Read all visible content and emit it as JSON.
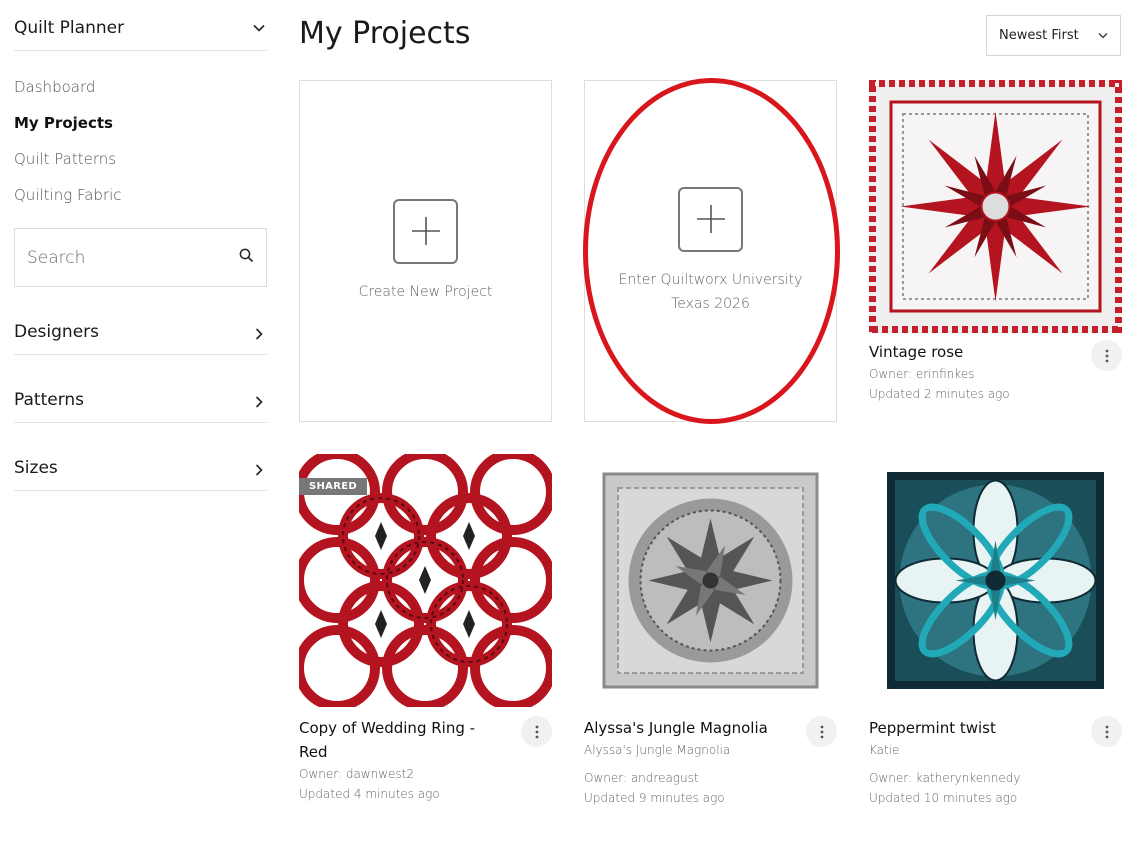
{
  "sidebar": {
    "title": "Quilt Planner",
    "nav": [
      {
        "label": "Dashboard",
        "active": false
      },
      {
        "label": "My Projects",
        "active": true
      },
      {
        "label": "Quilt Patterns",
        "active": false
      },
      {
        "label": "Quilting Fabric",
        "active": false
      }
    ],
    "search_placeholder": "Search",
    "sections": [
      {
        "label": "Designers"
      },
      {
        "label": "Patterns"
      },
      {
        "label": "Sizes"
      }
    ]
  },
  "header": {
    "title": "My Projects",
    "sort_value": "Newest First"
  },
  "create_cards": [
    {
      "label": "Create New Project"
    },
    {
      "label_line1": "Enter Quiltworx University",
      "label_line2": "Texas 2026"
    }
  ],
  "projects": [
    {
      "title": "Vintage rose",
      "subtitle": "",
      "owner": "Owner: erinfinkes",
      "updated": "Updated 2 minutes ago",
      "shared": false
    },
    {
      "title": "Copy of Wedding Ring - Red",
      "subtitle": "",
      "owner": "Owner: dawnwest2",
      "updated": "Updated 4 minutes ago",
      "shared": true,
      "badge": "SHARED"
    },
    {
      "title": "Alyssa's Jungle Magnolia",
      "subtitle": "Alyssa's Jungle Magnolia",
      "owner": "Owner: andreagust",
      "updated": "Updated 9 minutes ago",
      "shared": false
    },
    {
      "title": "Peppermint twist",
      "subtitle": "Katie",
      "owner": "Owner: katherynkennedy",
      "updated": "Updated 10 minutes ago",
      "shared": false
    }
  ],
  "colors": {
    "accent_highlight": "#d9161c",
    "quilt_red": "#b3141f",
    "quilt_teal": "#1e7f8a",
    "badge_bg": "#777777"
  },
  "icons": {
    "sidebar_header": "chevron-down-icon",
    "section": "chevron-right-icon",
    "search": "search-icon",
    "create": "plus-icon",
    "card_menu": "kebab-menu-icon"
  }
}
